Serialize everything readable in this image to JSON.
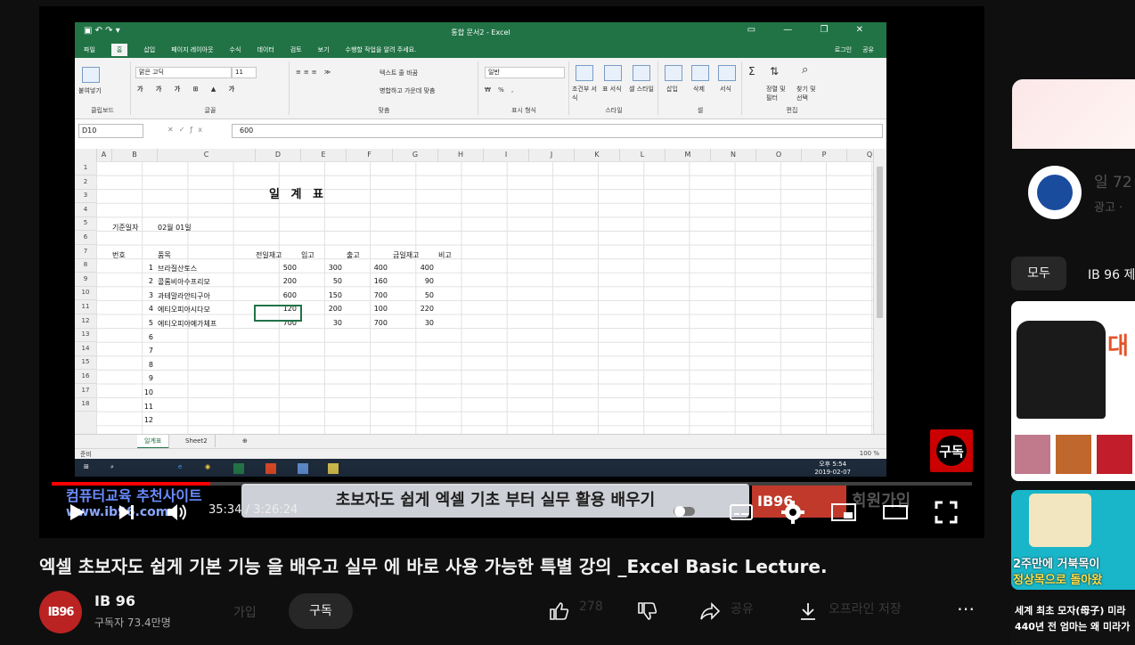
{
  "excel": {
    "window_title": "통합 문서2 - Excel",
    "account": {
      "login": "로그인",
      "share": "공유"
    },
    "menu": [
      "파일",
      "홈",
      "삽입",
      "페이지 레이아웃",
      "수식",
      "데이터",
      "검토",
      "보기",
      "수행할 작업을 알려 주세요."
    ],
    "active_menu": "홈",
    "ribbon": {
      "paste": "붙여넣기",
      "clipboard": "클립보드",
      "font_name": "맑은 고딕",
      "font_size": "11",
      "font_group": "글꼴",
      "wrap_text": "텍스트 줄 바꿈",
      "merge_center": "병합하고 가운데 맞춤",
      "align_group": "맞춤",
      "number_format": "일반",
      "number_group": "표시 형식",
      "cond_format": "조건부 서식",
      "table_format": "표 서식",
      "cell_style": "셀 스타일",
      "style_group": "스타일",
      "insert": "삽입",
      "delete": "삭제",
      "format": "서식",
      "cells_group": "셀",
      "sort_filter": "정렬 및 필터",
      "find_select": "찾기 및 선택",
      "edit_group": "편집"
    },
    "name_box": "D10",
    "formula_value": "600",
    "columns": [
      "A",
      "B",
      "C",
      "D",
      "E",
      "F",
      "G",
      "H",
      "I",
      "J",
      "K",
      "L",
      "M",
      "N",
      "O",
      "P",
      "Q"
    ],
    "rows": [
      "1",
      "2",
      "3",
      "4",
      "5",
      "6",
      "7",
      "8",
      "9",
      "10",
      "11",
      "12",
      "13",
      "14",
      "15",
      "16",
      "17",
      "18"
    ],
    "sheet_title": "일 계 표",
    "base_date_label": "기준일자",
    "base_date_value": "02월 01일",
    "headers": [
      "번호",
      "품목",
      "전일재고",
      "입고",
      "출고",
      "금일재고",
      "비고"
    ],
    "table": [
      {
        "no": "1",
        "item": "브라질산토스",
        "prev": "500",
        "in": "300",
        "out": "400",
        "today": "400"
      },
      {
        "no": "2",
        "item": "콜롬비아수프리모",
        "prev": "200",
        "in": "50",
        "out": "160",
        "today": "90"
      },
      {
        "no": "3",
        "item": "과테말라안티구아",
        "prev": "600",
        "in": "150",
        "out": "700",
        "today": "50"
      },
      {
        "no": "4",
        "item": "에티오피아시다모",
        "prev": "120",
        "in": "200",
        "out": "100",
        "today": "220"
      },
      {
        "no": "5",
        "item": "에티오피아예가체프",
        "prev": "700",
        "in": "30",
        "out": "700",
        "today": "30"
      }
    ],
    "extra_numbers": [
      "6",
      "7",
      "8",
      "9",
      "10",
      "11",
      "12"
    ],
    "sheet_tabs": [
      "일계표",
      "Sheet2"
    ],
    "status_ready": "준비",
    "zoom": "100 %",
    "clock_time": "오후 5:54",
    "clock_date": "2019-02-07"
  },
  "overlays": {
    "subscribe_watermark": "구독",
    "banner_left_line1": "컴퓨터교육 추천사이트",
    "banner_left_line2": "www.ib96.com",
    "banner_center": "초보자도 쉽게 엑셀 기초 부터 실무 활용 배우기",
    "banner_right_brand": "IB96",
    "banner_right_text": "회원가입"
  },
  "player": {
    "current_time": "35:34",
    "total_time": "3:26:24",
    "progress_fraction": 0.172
  },
  "video": {
    "title": "엑셀 초보자도 쉽게 기본 기능 을 배우고 실무 에 바로 사용 가능한 특별 강의 _Excel Basic Lecture.",
    "channel_name": "IB 96",
    "channel_avatar_text": "IB96",
    "subscribers": "구독자 73.4만명",
    "join_label": "가입",
    "subscribe_label": "구독",
    "likes": "278",
    "share_label": "공유",
    "offline_label": "오프라인 저장"
  },
  "sidebar": {
    "ad_line1": "일 72",
    "ad_line2": "광고 ·",
    "chip_all": "모두",
    "chip_channel": "IB 96 제",
    "thumb1_text": "대",
    "thumb2_line1": "2주만에 거북목이",
    "thumb2_line2": "정상목으로 돌아왔",
    "thumb3_line1": "세계 최초 모자(母子) 미라",
    "thumb3_line2": "440년 전 엄마는 왜 미라가"
  },
  "colors": {
    "excel_green": "#217346",
    "youtube_red": "#ff0000",
    "background": "#0f0f0f"
  }
}
